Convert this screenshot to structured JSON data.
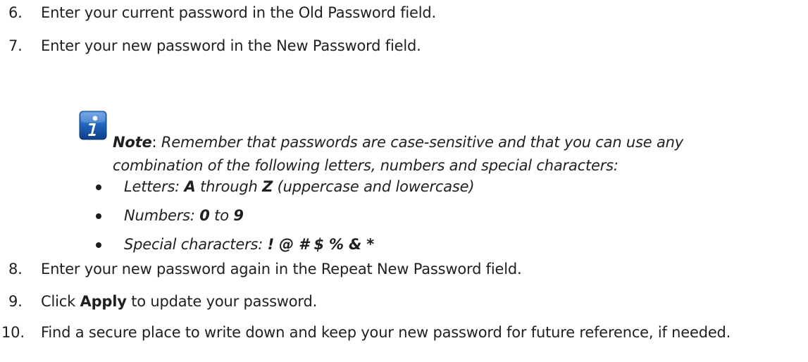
{
  "steps": [
    {
      "num": "6.",
      "text": "Enter your current password in the Old Password field."
    },
    {
      "num": "7.",
      "text": "Enter your new password in the New Password field."
    },
    {
      "num": "8.",
      "text": "Enter your new password again in the Repeat New Password field."
    },
    {
      "num": "9.",
      "text_before": "Click ",
      "bold": "Apply",
      "text_after": " to update your password."
    },
    {
      "num": "10.",
      "text": "Find a secure place to write down and keep your new password for future reference, if needed."
    }
  ],
  "note": {
    "icon": "info-icon",
    "label": "Note",
    "separator": ": ",
    "text": "Remember that passwords are case-sensitive and that you can use any combination of the following letters, numbers and special characters:",
    "bullets": [
      {
        "prefix": "Letters: ",
        "a": "A",
        "mid": " through ",
        "b": "Z",
        "suffix": " (uppercase and lowercase)"
      },
      {
        "prefix": "Numbers: ",
        "a": "0",
        "mid": " to ",
        "b": "9",
        "suffix": ""
      },
      {
        "prefix": "Special characters: ",
        "a": "! @ # $ % & *",
        "mid": "",
        "b": "",
        "suffix": ""
      }
    ]
  },
  "colors": {
    "text": "#1f1f1f",
    "icon_blue": "#1c5fb3"
  }
}
